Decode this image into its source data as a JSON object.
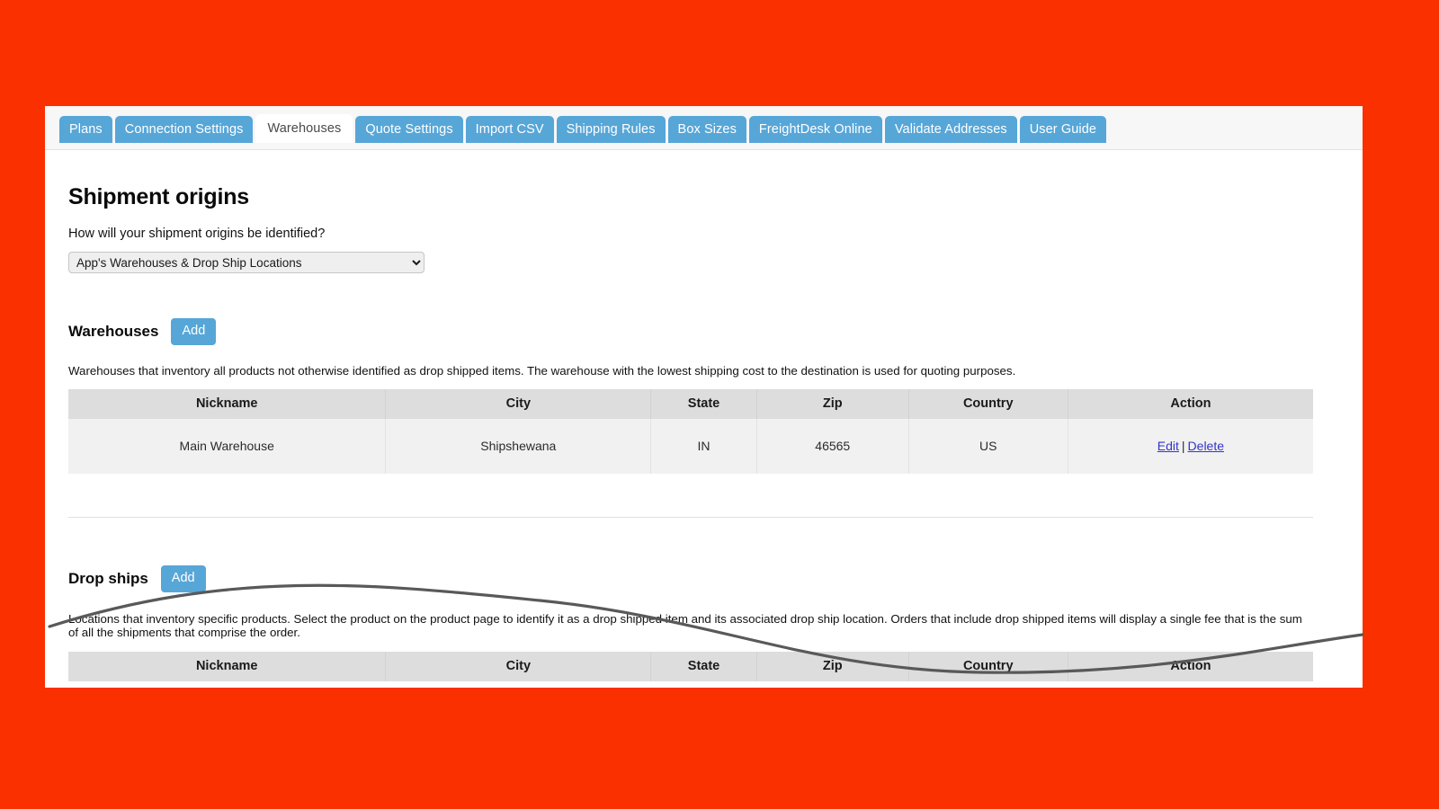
{
  "tabs": [
    {
      "label": "Plans",
      "active": false
    },
    {
      "label": "Connection Settings",
      "active": false
    },
    {
      "label": "Warehouses",
      "active": true
    },
    {
      "label": "Quote Settings",
      "active": false
    },
    {
      "label": "Import CSV",
      "active": false
    },
    {
      "label": "Shipping Rules",
      "active": false
    },
    {
      "label": "Box Sizes",
      "active": false
    },
    {
      "label": "FreightDesk Online",
      "active": false
    },
    {
      "label": "Validate Addresses",
      "active": false
    },
    {
      "label": "User Guide",
      "active": false
    }
  ],
  "page": {
    "title": "Shipment origins",
    "prompt": "How will your shipment origins be identified?",
    "origin_select": {
      "value": "App's Warehouses & Drop Ship Locations",
      "options": [
        "App's Warehouses & Drop Ship Locations"
      ]
    }
  },
  "warehouses": {
    "title": "Warehouses",
    "add_label": "Add",
    "description": "Warehouses that inventory all products not otherwise identified as drop shipped items. The warehouse with the lowest shipping cost to the destination is used for quoting purposes.",
    "columns": [
      "Nickname",
      "City",
      "State",
      "Zip",
      "Country",
      "Action"
    ],
    "rows": [
      {
        "nickname": "Main Warehouse",
        "city": "Shipshewana",
        "state": "IN",
        "zip": "46565",
        "country": "US",
        "edit_label": "Edit",
        "action_separator": "|",
        "delete_label": "Delete"
      }
    ]
  },
  "dropships": {
    "title": "Drop ships",
    "add_label": "Add",
    "description": "Locations that inventory specific products. Select the product on the product page to identify it as a drop shipped item and its associated drop ship location. Orders that include drop shipped items will display a single fee that is the sum of all the shipments that comprise the order.",
    "columns": [
      "Nickname",
      "City",
      "State",
      "Zip",
      "Country",
      "Action"
    ]
  },
  "colors": {
    "background": "#fa3000",
    "tab_blue": "#57a6d8",
    "link_blue": "#3333cc",
    "table_header": "#dddddd"
  }
}
